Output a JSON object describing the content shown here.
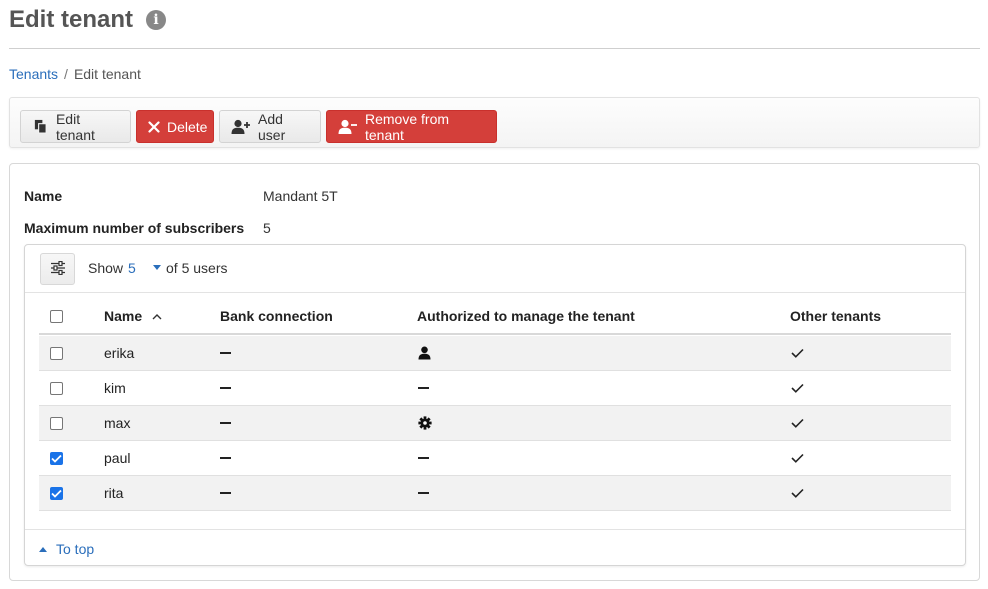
{
  "page": {
    "title": "Edit tenant",
    "info_icon": "info-icon"
  },
  "breadcrumb": {
    "root": "Tenants",
    "separator": "/",
    "current": "Edit tenant"
  },
  "toolbar": {
    "edit_label": "Edit tenant",
    "delete_label": "Delete",
    "add_user_label": "Add user",
    "remove_label": "Remove from tenant"
  },
  "details": {
    "name_label": "Name",
    "name_value": "Mandant 5T",
    "max_label": "Maximum number of subscribers",
    "max_value": "5"
  },
  "table": {
    "show_label": "Show",
    "page_size": "5",
    "of_label": "of 5 users",
    "columns": {
      "name": "Name",
      "bank": "Bank connection",
      "authorized": "Authorized to manage the tenant",
      "other": "Other tenants"
    },
    "rows": [
      {
        "name": "erika",
        "checked": false,
        "bank": "none",
        "authorized": "user-icon",
        "other": "check"
      },
      {
        "name": "kim",
        "checked": false,
        "bank": "none",
        "authorized": "none",
        "other": "check"
      },
      {
        "name": "max",
        "checked": false,
        "bank": "none",
        "authorized": "gear-icon",
        "other": "check"
      },
      {
        "name": "paul",
        "checked": true,
        "bank": "none",
        "authorized": "none",
        "other": "check"
      },
      {
        "name": "rita",
        "checked": true,
        "bank": "none",
        "authorized": "none",
        "other": "check"
      }
    ]
  },
  "footer": {
    "to_top": "To top"
  },
  "colors": {
    "link": "#2a6ebb",
    "danger": "#d43f3a",
    "checkbox": "#1a73e8"
  }
}
